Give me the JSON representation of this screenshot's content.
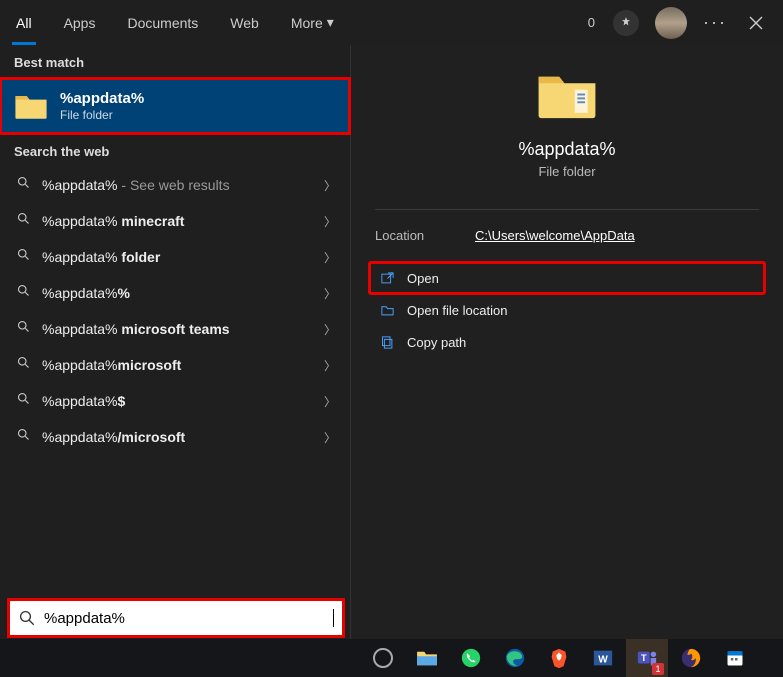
{
  "tabs": {
    "items": [
      {
        "label": "All",
        "active": true
      },
      {
        "label": "Apps",
        "active": false
      },
      {
        "label": "Documents",
        "active": false
      },
      {
        "label": "Web",
        "active": false
      },
      {
        "label": "More",
        "active": false,
        "dropdown": true
      }
    ],
    "rewards_count": "0"
  },
  "left": {
    "best_match_header": "Best match",
    "best_match": {
      "title": "%appdata%",
      "subtitle": "File folder"
    },
    "search_web_header": "Search the web",
    "web_results": [
      {
        "query": "%appdata%",
        "suffix": "",
        "hint": " - See web results"
      },
      {
        "query": "%appdata%",
        "suffix": " minecraft",
        "hint": ""
      },
      {
        "query": "%appdata%",
        "suffix": " folder",
        "hint": ""
      },
      {
        "query": "%appdata%",
        "suffix": "%",
        "hint": ""
      },
      {
        "query": "%appdata%",
        "suffix": " microsoft teams",
        "hint": ""
      },
      {
        "query": "%appdata%",
        "suffix": "microsoft",
        "hint": ""
      },
      {
        "query": "%appdata%",
        "suffix": "$",
        "hint": ""
      },
      {
        "query": "%appdata%",
        "suffix": "/microsoft",
        "hint": ""
      }
    ]
  },
  "right": {
    "title": "%appdata%",
    "subtitle": "File folder",
    "location_label": "Location",
    "location_value": "C:\\Users\\welcome\\AppData",
    "actions": [
      {
        "label": "Open",
        "icon": "open-icon",
        "highlight": true
      },
      {
        "label": "Open file location",
        "icon": "open-location-icon",
        "highlight": false
      },
      {
        "label": "Copy path",
        "icon": "copy-icon",
        "highlight": false
      }
    ]
  },
  "search": {
    "value": "%appdata%"
  },
  "taskbar": {
    "items": [
      {
        "name": "cortana",
        "color": "#aaaaaa"
      },
      {
        "name": "file-explorer",
        "color": "#ffcc4d"
      },
      {
        "name": "whatsapp",
        "color": "#25d366"
      },
      {
        "name": "edge",
        "color": "#0078d4"
      },
      {
        "name": "brave",
        "color": "#fb542b"
      },
      {
        "name": "word",
        "color": "#2b579a"
      },
      {
        "name": "teams",
        "color": "#6264a7",
        "badge": "1",
        "active": true
      },
      {
        "name": "firefox",
        "color": "#ff9500"
      },
      {
        "name": "calendar",
        "color": "#ffffff"
      }
    ]
  }
}
